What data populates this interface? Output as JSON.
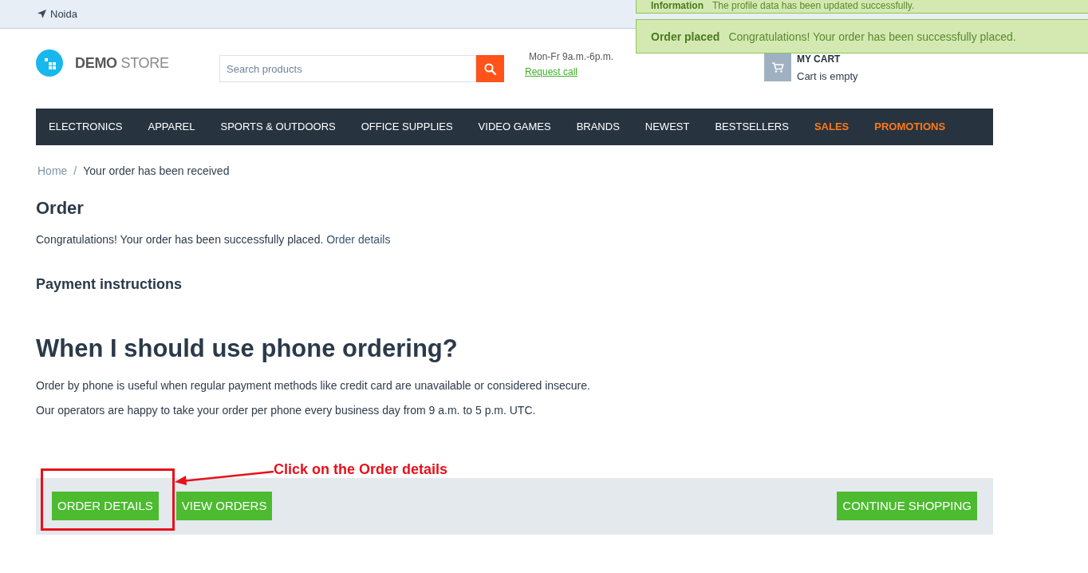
{
  "top_bar": {
    "location": "Noida"
  },
  "notifications": [
    {
      "title": "Information",
      "message": "The profile data has been updated successfully."
    },
    {
      "title": "Order placed",
      "message": "Congratulations! Your order has been successfully placed."
    }
  ],
  "header": {
    "logo": {
      "bold": "DEMO",
      "light": "STORE"
    },
    "search": {
      "placeholder": "Search products"
    },
    "hours": "Mon-Fr 9a.m.-6p.m.",
    "request_call": "Request call",
    "cart": {
      "title": "MY CART",
      "status": "Cart is empty"
    }
  },
  "menu": [
    {
      "label": "ELECTRONICS",
      "highlighted": false
    },
    {
      "label": "APPAREL",
      "highlighted": false
    },
    {
      "label": "SPORTS & OUTDOORS",
      "highlighted": false
    },
    {
      "label": "OFFICE SUPPLIES",
      "highlighted": false
    },
    {
      "label": "VIDEO GAMES",
      "highlighted": false
    },
    {
      "label": "BRANDS",
      "highlighted": false
    },
    {
      "label": "NEWEST",
      "highlighted": false
    },
    {
      "label": "BESTSELLERS",
      "highlighted": false
    },
    {
      "label": "SALES",
      "highlighted": true
    },
    {
      "label": "PROMOTIONS",
      "highlighted": true
    }
  ],
  "breadcrumb": {
    "separator": "/",
    "items": [
      {
        "label": "Home",
        "kind": "link"
      },
      {
        "label": "Your order has been received",
        "kind": "current"
      }
    ]
  },
  "order": {
    "title": "Order",
    "message": "Congratulations! Your order has been successfully placed.",
    "link": "Order details",
    "payment_title": "Payment instructions"
  },
  "info": {
    "title": "When I should use phone ordering?",
    "paragraphs": [
      "Order by phone is useful when regular payment methods like credit card are unavailable or considered insecure.",
      "Our operators are happy to take your order per phone every business day from 9 a.m. to 5 p.m. UTC."
    ]
  },
  "actions": {
    "left": [
      {
        "label": "ORDER DETAILS"
      },
      {
        "label": "VIEW ORDERS"
      }
    ],
    "right": [
      {
        "label": "CONTINUE SHOPPING"
      }
    ]
  },
  "annotation": {
    "text": "Click on the Order details"
  }
}
